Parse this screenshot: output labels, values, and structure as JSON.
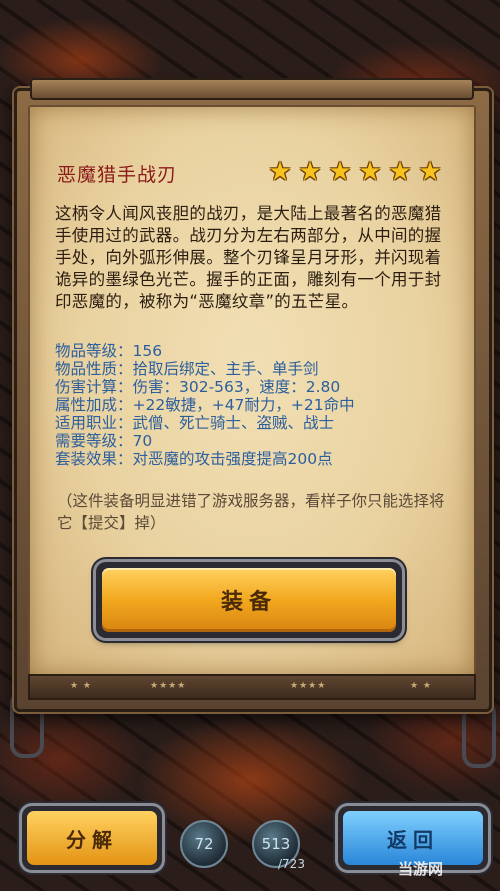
{
  "item": {
    "name": "恶魔猎手战刃",
    "rating": 6,
    "description": "这柄令人闻风丧胆的战刃，是大陆上最著名的恶魔猎手使用过的武器。战刃分为左右两部分，从中间的握手处，向外弧形伸展。整个刃锋呈月牙形，并闪现着诡异的墨绿色光芒。握手的正面，雕刻有一个用于封印恶魔的，被称为“恶魔纹章”的五芒星。",
    "stats": [
      "物品等级：156",
      "物品性质：拾取后绑定、主手、单手剑",
      "伤害计算：伤害：302-563，速度：2.80",
      "属性加成：+22敏捷，+47耐力，+21命中",
      "适用职业：武僧、死亡骑士、盗贼、战士",
      "需要等级：70",
      "套装效果：对恶魔的攻击强度提高200点"
    ],
    "note": "（这件装备明显进错了游戏服务器，看样子你只能选择将它【提交】掉）"
  },
  "buttons": {
    "equip": "装备",
    "split": "分解",
    "back": "返回"
  },
  "hud": {
    "orb_left": "72",
    "orb_right": "513",
    "orb_right_max": "/723"
  },
  "watermark": "当游网",
  "colors": {
    "title": "#8b1a1a",
    "stat_text": "#2c5f9e",
    "star": "#f7c21b",
    "gold_button": "#f2a81e",
    "blue_button": "#2a86d8"
  }
}
